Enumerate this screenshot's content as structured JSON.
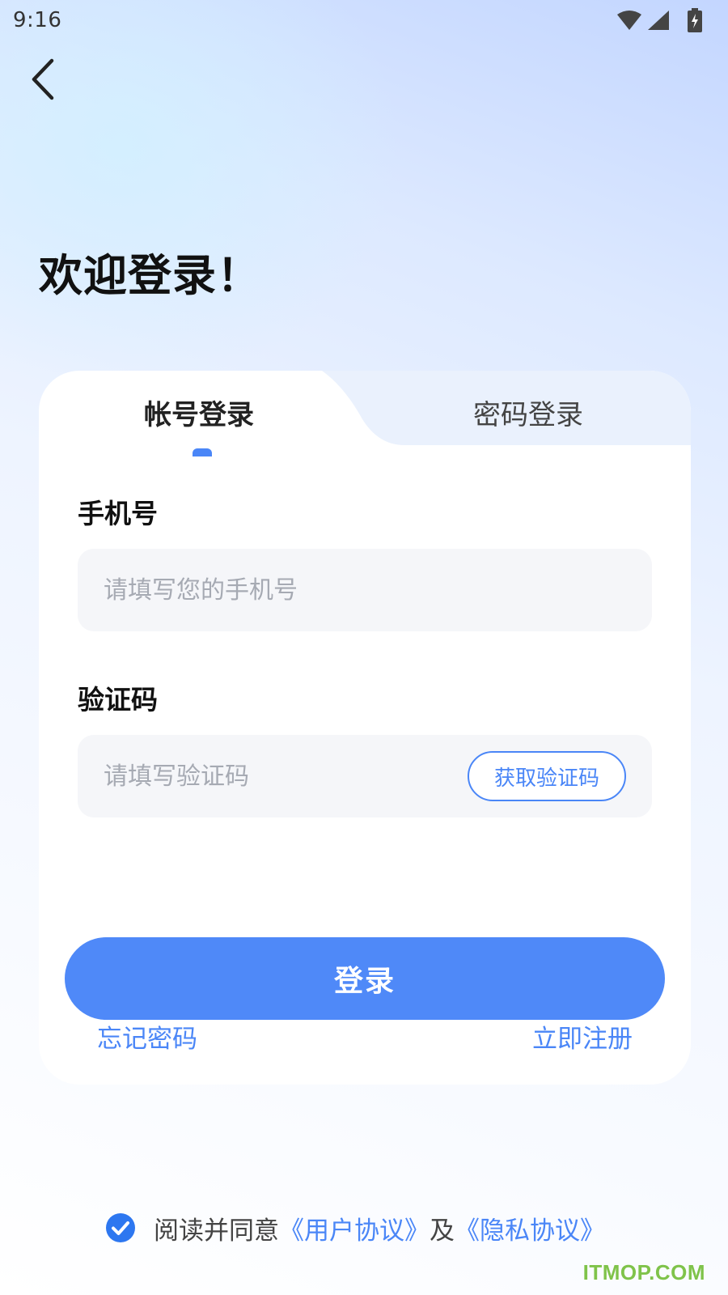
{
  "status_bar": {
    "time": "9:16"
  },
  "header": {
    "welcome_title": "欢迎登录！"
  },
  "tabs": [
    {
      "label": "帐号登录",
      "active": true
    },
    {
      "label": "密码登录",
      "active": false
    }
  ],
  "form": {
    "phone": {
      "label": "手机号",
      "placeholder": "请填写您的手机号",
      "value": ""
    },
    "code": {
      "label": "验证码",
      "placeholder": "请填写验证码",
      "value": "",
      "get_code_label": "获取验证码"
    }
  },
  "actions": {
    "login_label": "登录",
    "forgot_label": "忘记密码",
    "register_label": "立即注册"
  },
  "agreement": {
    "checked": true,
    "prefix": "阅读并同意",
    "user_agreement": "《用户协议》",
    "and": "及",
    "privacy_agreement": "《隐私协议》"
  },
  "watermark": "ITMOP.COM",
  "colors": {
    "accent": "#4f89f8",
    "link": "#4a86f7"
  },
  "icons": [
    "back-arrow-icon",
    "wifi-icon",
    "signal-icon",
    "battery-charging-icon",
    "checkbox-checked-icon"
  ]
}
